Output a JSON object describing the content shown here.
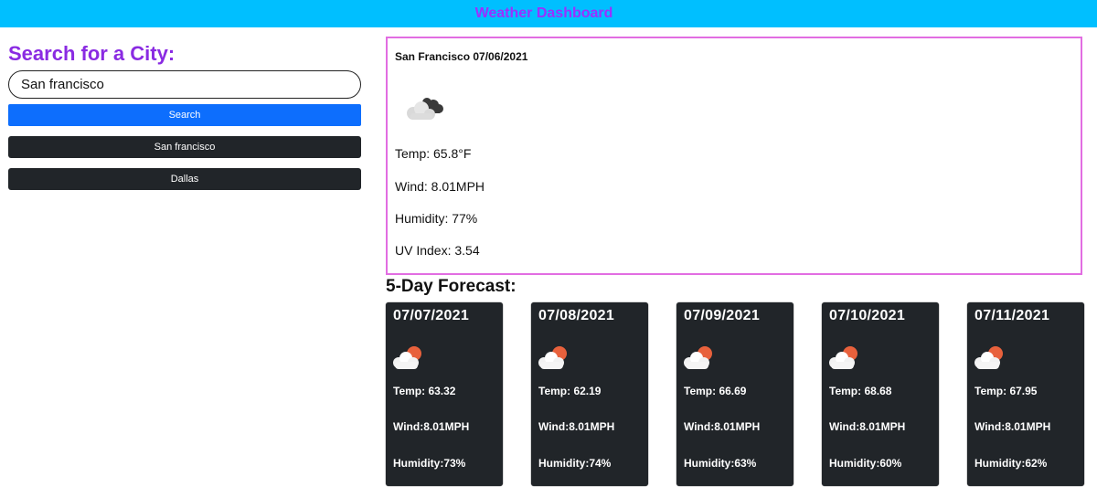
{
  "header": {
    "title": "Weather Dashboard"
  },
  "search": {
    "heading": "Search for a City:",
    "input_value": "San francisco",
    "button_label": "Search"
  },
  "history": [
    {
      "label": "San francisco"
    },
    {
      "label": "Dallas"
    }
  ],
  "current": {
    "title": "San Francisco 07/06/2021",
    "icon": "cloudy-icon",
    "temp": "Temp: 65.8°F",
    "wind": "Wind: 8.01MPH",
    "humidity": "Humidity: 77%",
    "uv": "UV Index: 3.54"
  },
  "forecast": {
    "heading": "5-Day Forecast:",
    "days": [
      {
        "date": "07/07/2021",
        "icon": "partly-cloudy-icon",
        "temp": "Temp: 63.32",
        "wind": "Wind:8.01MPH",
        "humidity": "Humidity:73%"
      },
      {
        "date": "07/08/2021",
        "icon": "partly-cloudy-icon",
        "temp": "Temp: 62.19",
        "wind": "Wind:8.01MPH",
        "humidity": "Humidity:74%"
      },
      {
        "date": "07/09/2021",
        "icon": "partly-cloudy-icon",
        "temp": "Temp: 66.69",
        "wind": "Wind:8.01MPH",
        "humidity": "Humidity:63%"
      },
      {
        "date": "07/10/2021",
        "icon": "partly-cloudy-icon",
        "temp": "Temp: 68.68",
        "wind": "Wind:8.01MPH",
        "humidity": "Humidity:60%"
      },
      {
        "date": "07/11/2021",
        "icon": "partly-cloudy-icon",
        "temp": "Temp: 67.95",
        "wind": "Wind:8.01MPH",
        "humidity": "Humidity:62%"
      }
    ]
  },
  "colors": {
    "header_bg": "#00bfff",
    "accent_purple": "#8a2be2",
    "search_button": "#0d6efd",
    "dark_card": "#212529",
    "current_border": "#e26de2"
  }
}
